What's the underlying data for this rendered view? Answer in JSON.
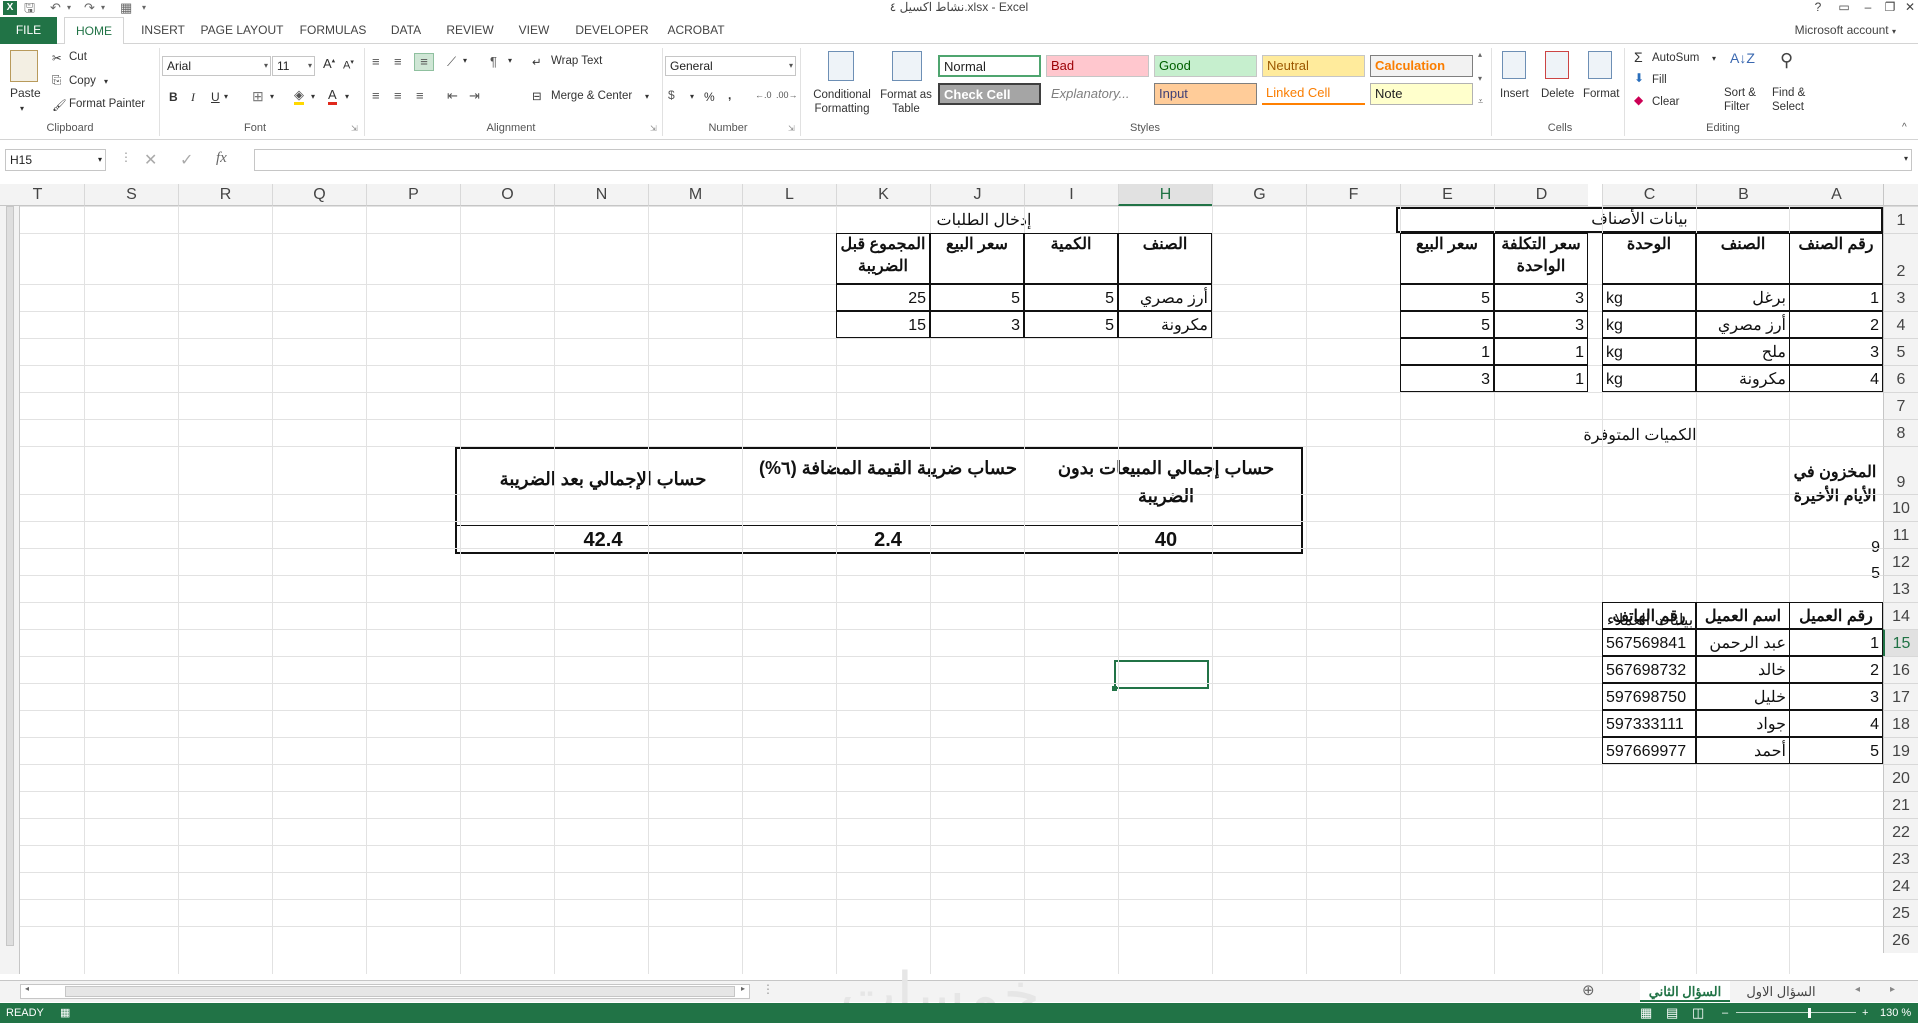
{
  "window": {
    "title": "نشاط اكسيل ٤.xlsx - Excel",
    "help": "?",
    "controls": [
      "▭",
      "–",
      "❐",
      "✕"
    ]
  },
  "ribbon_tabs": [
    "FILE",
    "HOME",
    "INSERT",
    "PAGE LAYOUT",
    "FORMULAS",
    "DATA",
    "REVIEW",
    "VIEW",
    "DEVELOPER",
    "ACROBAT"
  ],
  "account": "Microsoft account",
  "clipboard": {
    "paste": "Paste",
    "cut": "Cut",
    "copy": "Copy",
    "format_painter": "Format Painter",
    "label": "Clipboard"
  },
  "font": {
    "name": "Arial",
    "size": "11",
    "bold": "B",
    "italic": "I",
    "underline": "U",
    "label": "Font"
  },
  "alignment": {
    "wrap": "Wrap Text",
    "merge": "Merge & Center",
    "label": "Alignment"
  },
  "number": {
    "format": "General",
    "percent": "%",
    "comma": ",",
    "label": "Number"
  },
  "styles": {
    "conditional": "Conditional Formatting",
    "format_table": "Format as Table",
    "cells": [
      "Normal",
      "Bad",
      "Good",
      "Neutral",
      "Calculation",
      "Check Cell",
      "Explanatory...",
      "Input",
      "Linked Cell",
      "Note"
    ],
    "label": "Styles"
  },
  "cells_group": {
    "insert": "Insert",
    "delete": "Delete",
    "format": "Format",
    "label": "Cells"
  },
  "editing": {
    "autosum": "AutoSum",
    "fill": "Fill",
    "clear": "Clear",
    "sort": "Sort & Filter",
    "find": "Find & Select",
    "label": "Editing"
  },
  "formula_bar": {
    "name_box": "H15",
    "fx": "fx",
    "content": ""
  },
  "columns": [
    "A",
    "B",
    "C",
    "D",
    "E",
    "F",
    "G",
    "H",
    "I",
    "J",
    "K",
    "L",
    "M",
    "N",
    "O",
    "P",
    "Q",
    "R",
    "S",
    "T"
  ],
  "rows": [
    "1",
    "2",
    "3",
    "4",
    "5",
    "6",
    "7",
    "8",
    "9",
    "10",
    "11",
    "12",
    "13",
    "14",
    "15",
    "16",
    "17",
    "18",
    "19",
    "20",
    "21",
    "22",
    "23",
    "24",
    "25",
    "26"
  ],
  "items_table": {
    "title": "بيانات الأصناف",
    "headers": [
      "رقم الصنف",
      "الصنف",
      "الوحدة",
      "سعر التكلفة الواحدة",
      "سعر البيع"
    ],
    "rows": [
      [
        "1",
        "برغل",
        "kg",
        "3",
        "5"
      ],
      [
        "2",
        "أرز مصري",
        "kg",
        "3",
        "5"
      ],
      [
        "3",
        "ملح",
        "kg",
        "1",
        "1"
      ],
      [
        "4",
        "مكرونة",
        "kg",
        "1",
        "3"
      ]
    ]
  },
  "stock": {
    "title": "الكميات المتوفرة",
    "header": "المخزون في الأيام الأخيرة",
    "values": [
      "9",
      "5"
    ]
  },
  "orders_table": {
    "title": "إدخال الطلبات",
    "headers": [
      "الصنف",
      "الكمية",
      "سعر البيع",
      "المجموع قبل الضريبة"
    ],
    "rows": [
      [
        "أرز مصري",
        "5",
        "5",
        "25"
      ],
      [
        "مكرونة",
        "5",
        "3",
        "15"
      ]
    ]
  },
  "summary": {
    "headers": [
      "حساب إجمالي المبيعات بدون الضريبة",
      "حساب ضريبة القيمة المضافة (٦%)",
      "حساب الإجمالي بعد الضريبة"
    ],
    "values": [
      "40",
      "2.4",
      "42.4"
    ]
  },
  "customers": {
    "title": "بيانات العملاء",
    "headers": [
      "رقم العميل",
      "اسم العميل",
      "رقم الهاتف"
    ],
    "rows": [
      [
        "1",
        "عبد الرحمن",
        "567569841"
      ],
      [
        "2",
        "خالد",
        "567698732"
      ],
      [
        "3",
        "خليل",
        "597698750"
      ],
      [
        "4",
        "جواد",
        "597333111"
      ],
      [
        "5",
        "أحمد",
        "597669977"
      ]
    ]
  },
  "sheets": [
    "السؤال الاول",
    "السؤال الثاني"
  ],
  "status": {
    "ready": "READY",
    "zoom": "130 %"
  },
  "watermark": "خمسات"
}
